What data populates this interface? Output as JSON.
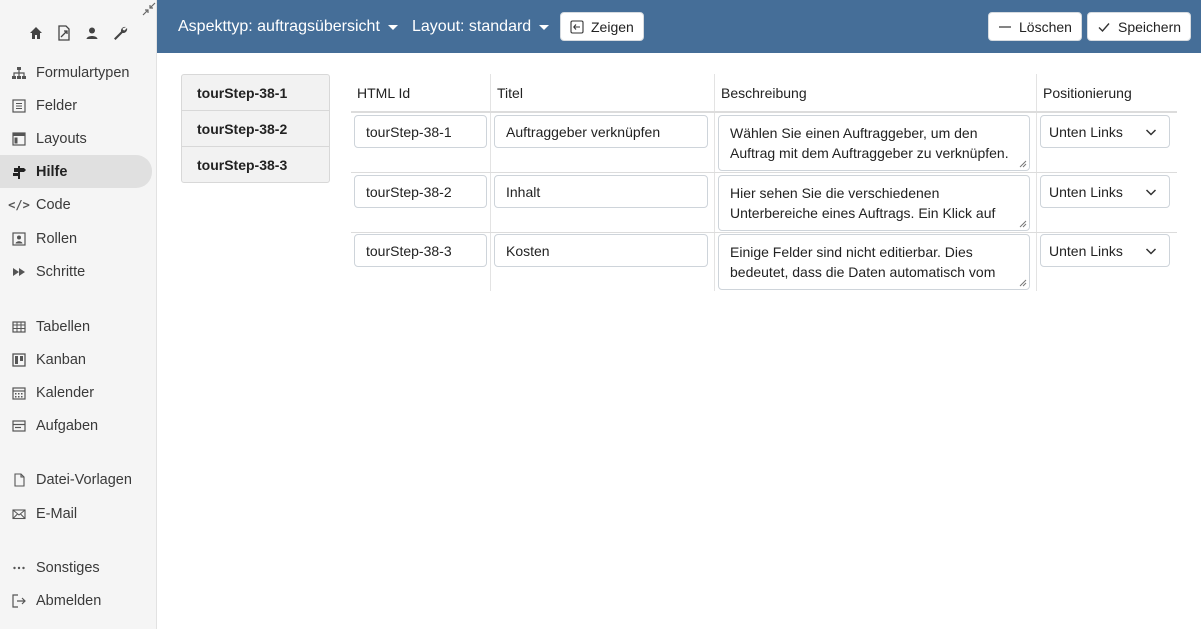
{
  "sidebar": {
    "top_icons": [
      "home-icon",
      "file-share-icon",
      "user-icon",
      "wrench-icon"
    ],
    "items": [
      {
        "label": "Formulartypen",
        "icon": "sitemap-icon"
      },
      {
        "label": "Felder",
        "icon": "list-icon"
      },
      {
        "label": "Layouts",
        "icon": "layout-icon"
      },
      {
        "label": "Hilfe",
        "icon": "signpost-icon",
        "active": true
      },
      {
        "label": "Code",
        "icon": "code-icon"
      },
      {
        "label": "Rollen",
        "icon": "user-square-icon"
      },
      {
        "label": "Schritte",
        "icon": "fast-forward-icon"
      },
      {
        "label": "Tabellen",
        "icon": "table-icon"
      },
      {
        "label": "Kanban",
        "icon": "kanban-icon"
      },
      {
        "label": "Kalender",
        "icon": "calendar-icon"
      },
      {
        "label": "Aufgaben",
        "icon": "tasks-icon"
      },
      {
        "label": "Datei-Vorlagen",
        "icon": "file-icon"
      },
      {
        "label": "E-Mail",
        "icon": "envelope-icon"
      },
      {
        "label": "Sonstiges",
        "icon": "ellipsis-icon"
      },
      {
        "label": "Abmelden",
        "icon": "logout-icon"
      }
    ]
  },
  "header": {
    "aspect_dropdown": "Aspekttyp: auftragsübersicht",
    "layout_dropdown": "Layout: standard",
    "show_button": "Zeigen",
    "delete_button": "Löschen",
    "save_button": "Speichern",
    "background_color": "#456e98"
  },
  "steps": [
    "tourStep-38-1",
    "tourStep-38-2",
    "tourStep-38-3"
  ],
  "table": {
    "columns": [
      "HTML Id",
      "Titel",
      "Beschreibung",
      "Positionierung"
    ],
    "rows": [
      {
        "html_id": "tourStep-38-1",
        "title": "Auftraggeber verknüpfen",
        "description": "Wählen Sie einen Auftraggeber, um den Auftrag mit dem Auftraggeber zu verknüpfen.",
        "position": "Unten Links"
      },
      {
        "html_id": "tourStep-38-2",
        "title": "Inhalt",
        "description": "Hier sehen Sie die verschiedenen Unterbereiche eines Auftrags. Ein Klick auf",
        "position": "Unten Links"
      },
      {
        "html_id": "tourStep-38-3",
        "title": "Kosten",
        "description": "Einige Felder sind nicht editierbar. Dies bedeutet, dass die Daten automatisch vom",
        "position": "Unten Links"
      }
    ]
  }
}
